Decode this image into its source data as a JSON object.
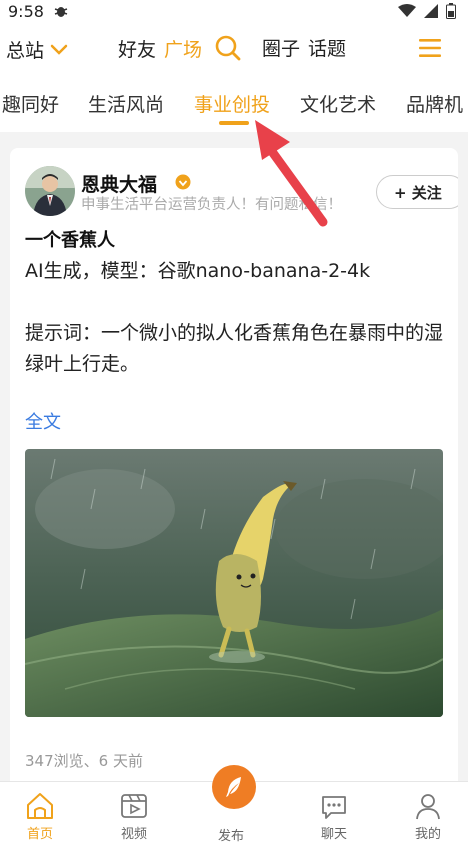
{
  "status_bar": {
    "time": "9:58"
  },
  "top_nav": {
    "site_switch": "总站",
    "friends": "好友",
    "square": "广场",
    "circles": "圈子",
    "topics": "话题"
  },
  "categories": {
    "items": [
      "趣同好",
      "生活风尚",
      "事业创投",
      "文化艺术",
      "品牌机"
    ],
    "active": "事业创投"
  },
  "post": {
    "author": {
      "name": "恩典大福",
      "bio": "申事生活平台运营负责人！有问题私信！"
    },
    "follow_label": "+ 关注",
    "title": "一个香蕉人",
    "body_line1": "AI生成，模型：谷歌nano-banana-2-4k",
    "body_line2": "提示词：一个微小的拟人化香蕉角色在暴雨中的湿绿叶上行走。",
    "read_more": "全文",
    "meta": "347浏览、6 天前"
  },
  "bottom_tabs": {
    "home": "首页",
    "video": "视频",
    "publish": "发布",
    "chat": "聊天",
    "mine": "我的"
  },
  "colors": {
    "accent": "#f0a21b",
    "publish": "#ef7d24",
    "link": "#3a7be0"
  }
}
